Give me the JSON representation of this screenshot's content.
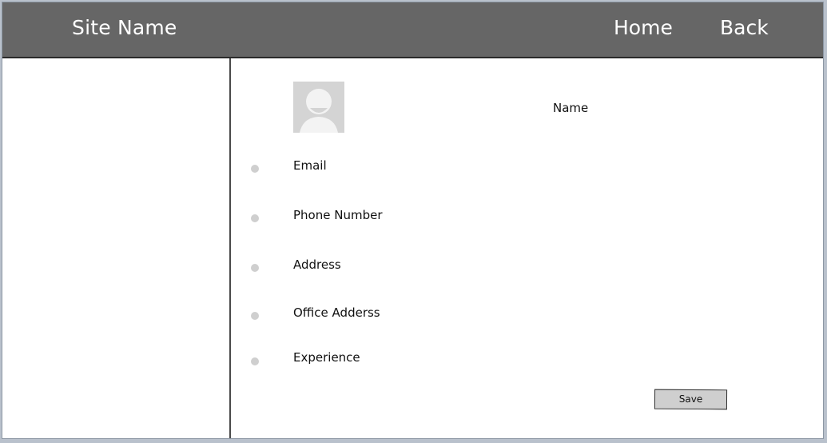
{
  "header": {
    "site_name": "Site Name",
    "nav": {
      "home": "Home",
      "back": "Back"
    }
  },
  "profile": {
    "name_label": "Name",
    "fields": [
      {
        "label": "Email"
      },
      {
        "label": "Phone Number"
      },
      {
        "label": "Address"
      },
      {
        "label": "Office Adderss"
      },
      {
        "label": "Experience"
      }
    ]
  },
  "actions": {
    "save_label": "Save"
  },
  "colors": {
    "header_bg": "#666666",
    "avatar_bg": "#d4d4d4",
    "button_bg": "#cfcfcf"
  },
  "icons": {
    "avatar": "user-placeholder-icon",
    "bullet": "bullet-dot-icon"
  }
}
